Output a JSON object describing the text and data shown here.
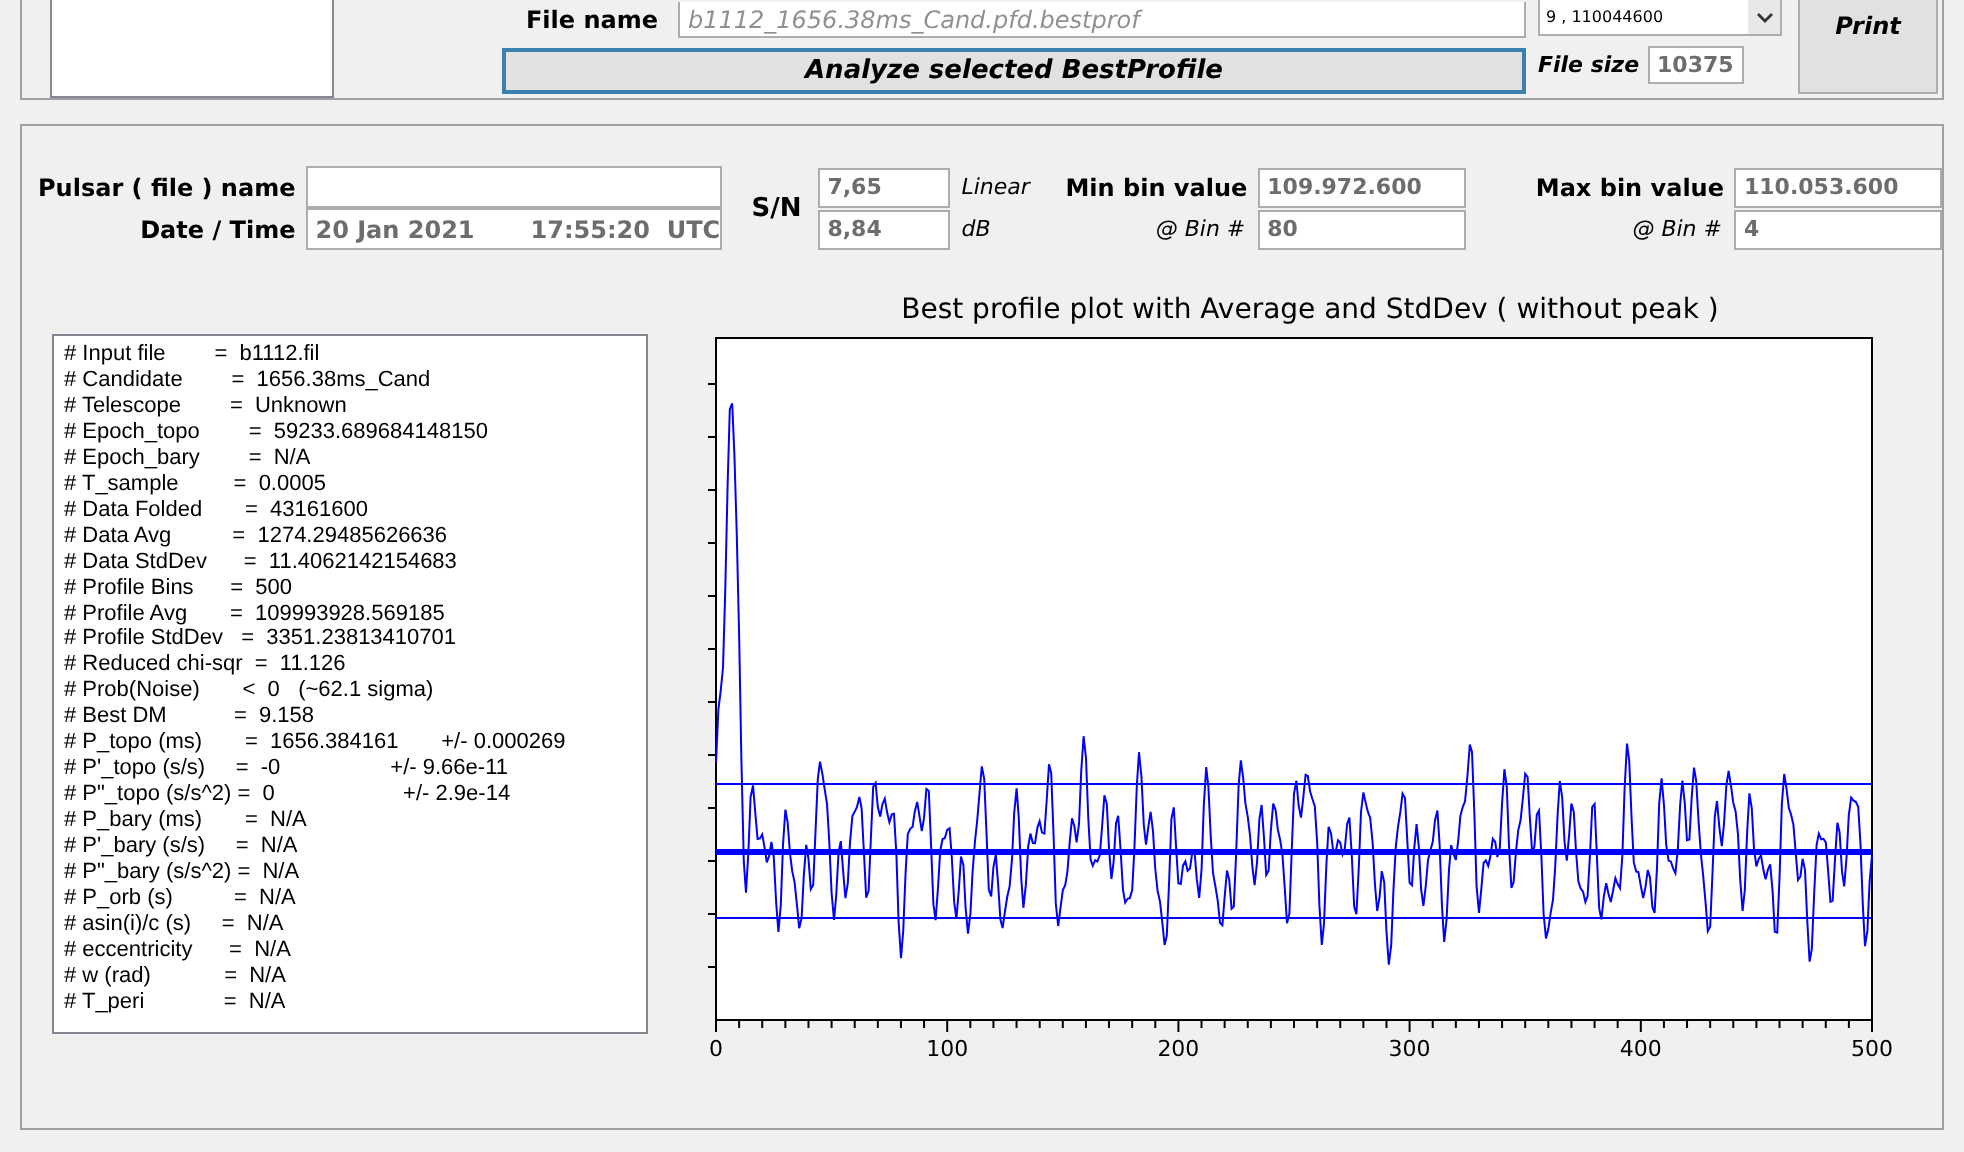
{
  "top": {
    "file_label": "File name",
    "file_name": "b1112_1656.38ms_Cand.pfd.bestprof",
    "list_entries": [
      "9 , 110044600"
    ],
    "analyze_button": "Analyze selected BestProfile",
    "file_size_label": "File size",
    "file_size": "10375",
    "print_button": "Print"
  },
  "info": {
    "pulsar_label": "Pulsar ( file ) name",
    "date_label": "Date / Time",
    "date": "20 Jan 2021",
    "time": "17:55:20  UTC",
    "sn_label": "S/N",
    "sn_linear": "7,65",
    "linear_label": "Linear",
    "sn_db": "8,84",
    "db_label": "dB",
    "min_label": "Min bin value",
    "min_value": "109.972.600",
    "min_bin_label": "@ Bin #",
    "min_bin": "80",
    "max_label": "Max bin value",
    "max_value": "110.053.600",
    "max_bin_label": "@ Bin #",
    "max_bin": "4"
  },
  "report": {
    "lines": [
      "# Input file        =  b1112.fil",
      "# Candidate        =  1656.38ms_Cand",
      "# Telescope        =  Unknown",
      "# Epoch_topo        =  59233.689684148150",
      "# Epoch_bary        =  N/A",
      "# T_sample         =  0.0005",
      "# Data Folded       =  43161600",
      "# Data Avg          =  1274.29485626636",
      "# Data StdDev      =  11.4062142154683",
      "# Profile Bins      =  500",
      "# Profile Avg       =  109993928.569185",
      "# Profile StdDev   =  3351.23813410701",
      "# Reduced chi-sqr  =  11.126",
      "# Prob(Noise)       <  0   (~62.1 sigma)",
      "# Best DM           =  9.158",
      "# P_topo (ms)       =  1656.384161       +/- 0.000269",
      "# P'_topo (s/s)     =  -0                  +/- 9.66e-11",
      "# P\"_topo (s/s^2) =  0                     +/- 2.9e-14",
      "# P_bary (ms)       =  N/A",
      "# P'_bary (s/s)     =  N/A",
      "# P\"_bary (s/s^2) =  N/A",
      "# P_orb (s)          =  N/A",
      "# asin(i)/c (s)     =  N/A",
      "# eccentricity      =  N/A",
      "# w (rad)            =  N/A",
      "# T_peri             =  N/A"
    ]
  },
  "plot": {
    "title": "Best profile plot with  Average and StdDev ( without peak )",
    "x_tick_labels": [
      "0",
      "100",
      "200",
      "300",
      "400",
      "500"
    ]
  }
}
